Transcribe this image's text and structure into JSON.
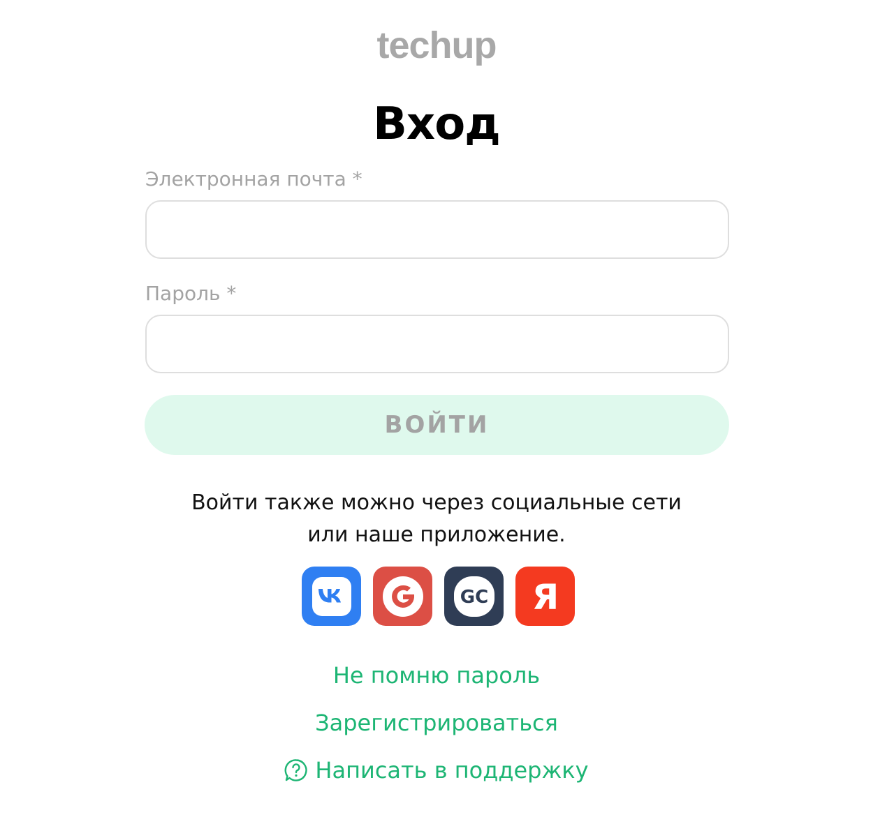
{
  "logo": {
    "text": "techup"
  },
  "title": "Вход",
  "form": {
    "email_label": "Электронная почта *",
    "email_value": "",
    "password_label": "Пароль *",
    "password_value": "",
    "submit_label": "ВОЙТИ"
  },
  "social": {
    "line1": "Войти также можно через социальные сети",
    "line2": "или наше приложение.",
    "providers": [
      {
        "icon": "vk-icon",
        "color": "#2f7ff2"
      },
      {
        "icon": "google-icon",
        "color": "#dc4f45"
      },
      {
        "icon": "gc-icon",
        "color": "#2f3d55"
      },
      {
        "icon": "yandex-icon",
        "color": "#f43a20"
      }
    ]
  },
  "links": {
    "forgot": "Не помню пароль",
    "register": "Зарегистрироваться",
    "support": "Написать в поддержку"
  },
  "colors": {
    "accent": "#1db574",
    "button_bg": "#dff9ed",
    "muted": "#a3a3a3"
  }
}
